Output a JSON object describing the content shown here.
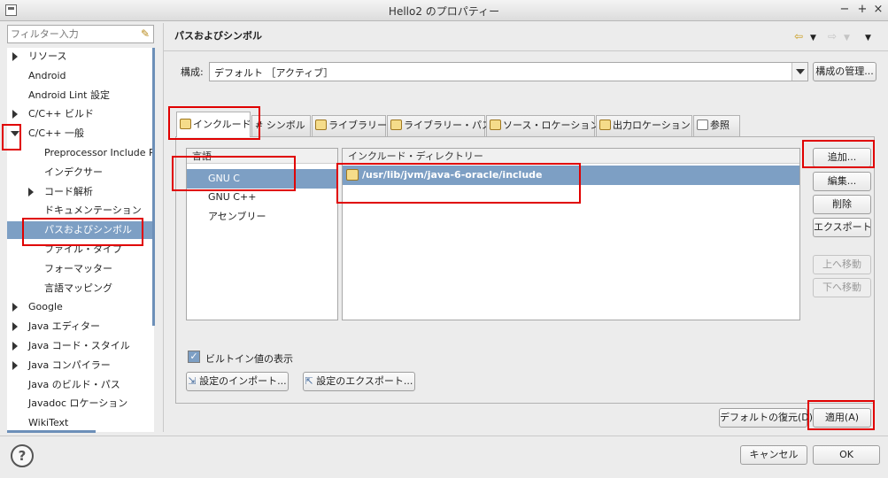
{
  "window": {
    "title": "Hello2 のプロパティー",
    "controls": {
      "minimize": "−",
      "maximize": "+",
      "close": "×"
    }
  },
  "filter": {
    "placeholder": "フィルター入力",
    "icon": "broom-icon"
  },
  "tree": {
    "items": [
      {
        "label": "リソース",
        "arrow": "right"
      },
      {
        "label": "Android",
        "arrow": ""
      },
      {
        "label": "Android Lint 設定",
        "arrow": ""
      },
      {
        "label": "C/C++ ビルド",
        "arrow": "right"
      },
      {
        "label": "C/C++ 一般",
        "arrow": "down"
      },
      {
        "label": "Preprocessor Include Paths",
        "arrow": ""
      },
      {
        "label": "インデクサー",
        "arrow": ""
      },
      {
        "label": "コード解析",
        "arrow": "right"
      },
      {
        "label": "ドキュメンテーション",
        "arrow": ""
      },
      {
        "label": "パスおよびシンボル",
        "arrow": ""
      },
      {
        "label": "ファイル・タイプ",
        "arrow": ""
      },
      {
        "label": "フォーマッター",
        "arrow": ""
      },
      {
        "label": "言語マッピング",
        "arrow": ""
      },
      {
        "label": "Google",
        "arrow": "right"
      },
      {
        "label": "Java エディター",
        "arrow": "right"
      },
      {
        "label": "Java コード・スタイル",
        "arrow": "right"
      },
      {
        "label": "Java コンパイラー",
        "arrow": "right"
      },
      {
        "label": "Java のビルド・パス",
        "arrow": ""
      },
      {
        "label": "Javadoc ロケーション",
        "arrow": ""
      },
      {
        "label": "WikiText",
        "arrow": ""
      }
    ],
    "selected": "パスおよびシンボル"
  },
  "page": {
    "title": "パスおよびシンボル"
  },
  "config": {
    "label": "構成:",
    "value": "デフォルト ［アクティブ］",
    "manage_button": "構成の管理..."
  },
  "tabs": [
    {
      "label": "インクルード"
    },
    {
      "label": "# シンボル"
    },
    {
      "label": "ライブラリー"
    },
    {
      "label": "ライブラリー・パス"
    },
    {
      "label": "ソース・ロケーション"
    },
    {
      "label": "出力ロケーション"
    },
    {
      "label": "参照"
    }
  ],
  "active_tab": "インクルード",
  "languages": {
    "header": "言語",
    "items": [
      "GNU C",
      "GNU C++",
      "アセンブリー"
    ],
    "selected": "GNU C"
  },
  "include_dirs": {
    "header": "インクルード・ディレクトリー",
    "items": [
      "/usr/lib/jvm/java-6-oracle/include"
    ]
  },
  "side_buttons": {
    "add": "追加...",
    "edit": "編集...",
    "delete": "削除",
    "export": "エクスポート",
    "move_up": "上へ移動",
    "move_down": "下へ移動"
  },
  "show_builtin": {
    "label": "ビルトイン値の表示",
    "checked": true
  },
  "import_button": "設定のインポート...",
  "export_button": "設定のエクスポート...",
  "restore_defaults": "デフォルトの復元(D)",
  "apply": "適用(A)",
  "cancel": "キャンセル",
  "ok": "OK",
  "colors": {
    "selection": "#7d9fc4",
    "annotation": "#e00000"
  }
}
